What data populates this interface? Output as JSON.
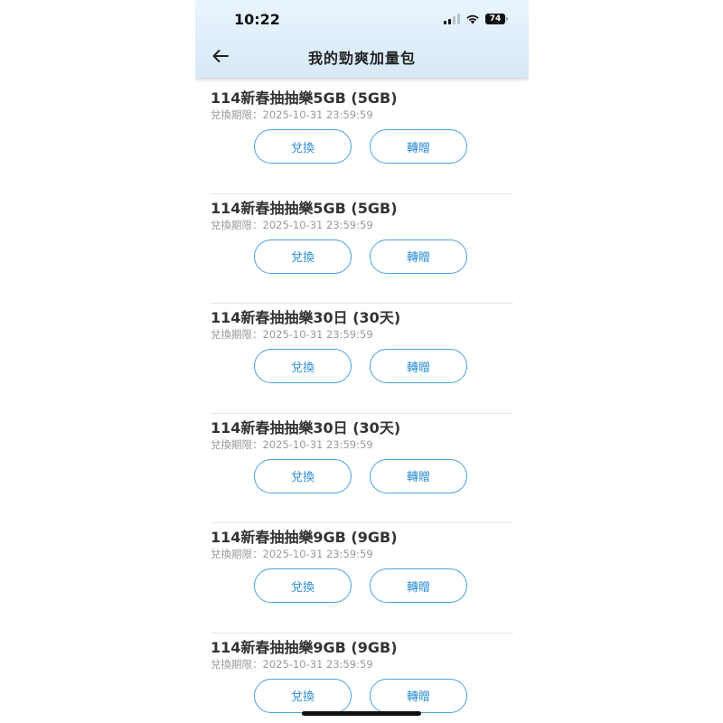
{
  "status_bar": {
    "time": "10:22",
    "battery": "74",
    "signal_icon": "cellular-signal-icon",
    "wifi_icon": "wifi-icon"
  },
  "header": {
    "title": "我的勁爽加量包",
    "back_icon": "arrow-left-icon"
  },
  "items": [
    {
      "title": "114新春抽抽樂5GB (5GB)",
      "expiry": "兌換期限：2025-10-31 23:59:59",
      "redeem_label": "兌換",
      "gift_label": "轉贈"
    },
    {
      "title": "114新春抽抽樂5GB (5GB)",
      "expiry": "兌換期限：2025-10-31 23:59:59",
      "redeem_label": "兌換",
      "gift_label": "轉贈"
    },
    {
      "title": "114新春抽抽樂30日 (30天)",
      "expiry": "兌換期限：2025-10-31 23:59:59",
      "redeem_label": "兌換",
      "gift_label": "轉贈"
    },
    {
      "title": "114新春抽抽樂30日 (30天)",
      "expiry": "兌換期限：2025-10-31 23:59:59",
      "redeem_label": "兌換",
      "gift_label": "轉贈"
    },
    {
      "title": "114新春抽抽樂9GB (9GB)",
      "expiry": "兌換期限：2025-10-31 23:59:59",
      "redeem_label": "兌換",
      "gift_label": "轉贈"
    },
    {
      "title": "114新春抽抽樂9GB (9GB)",
      "expiry": "兌換期限：2025-10-31 23:59:59",
      "redeem_label": "兌換",
      "gift_label": "轉贈"
    }
  ],
  "colors": {
    "accent": "#2f8fd3",
    "button_border": "#4aa3df",
    "header_bg": "#dcedfa"
  }
}
